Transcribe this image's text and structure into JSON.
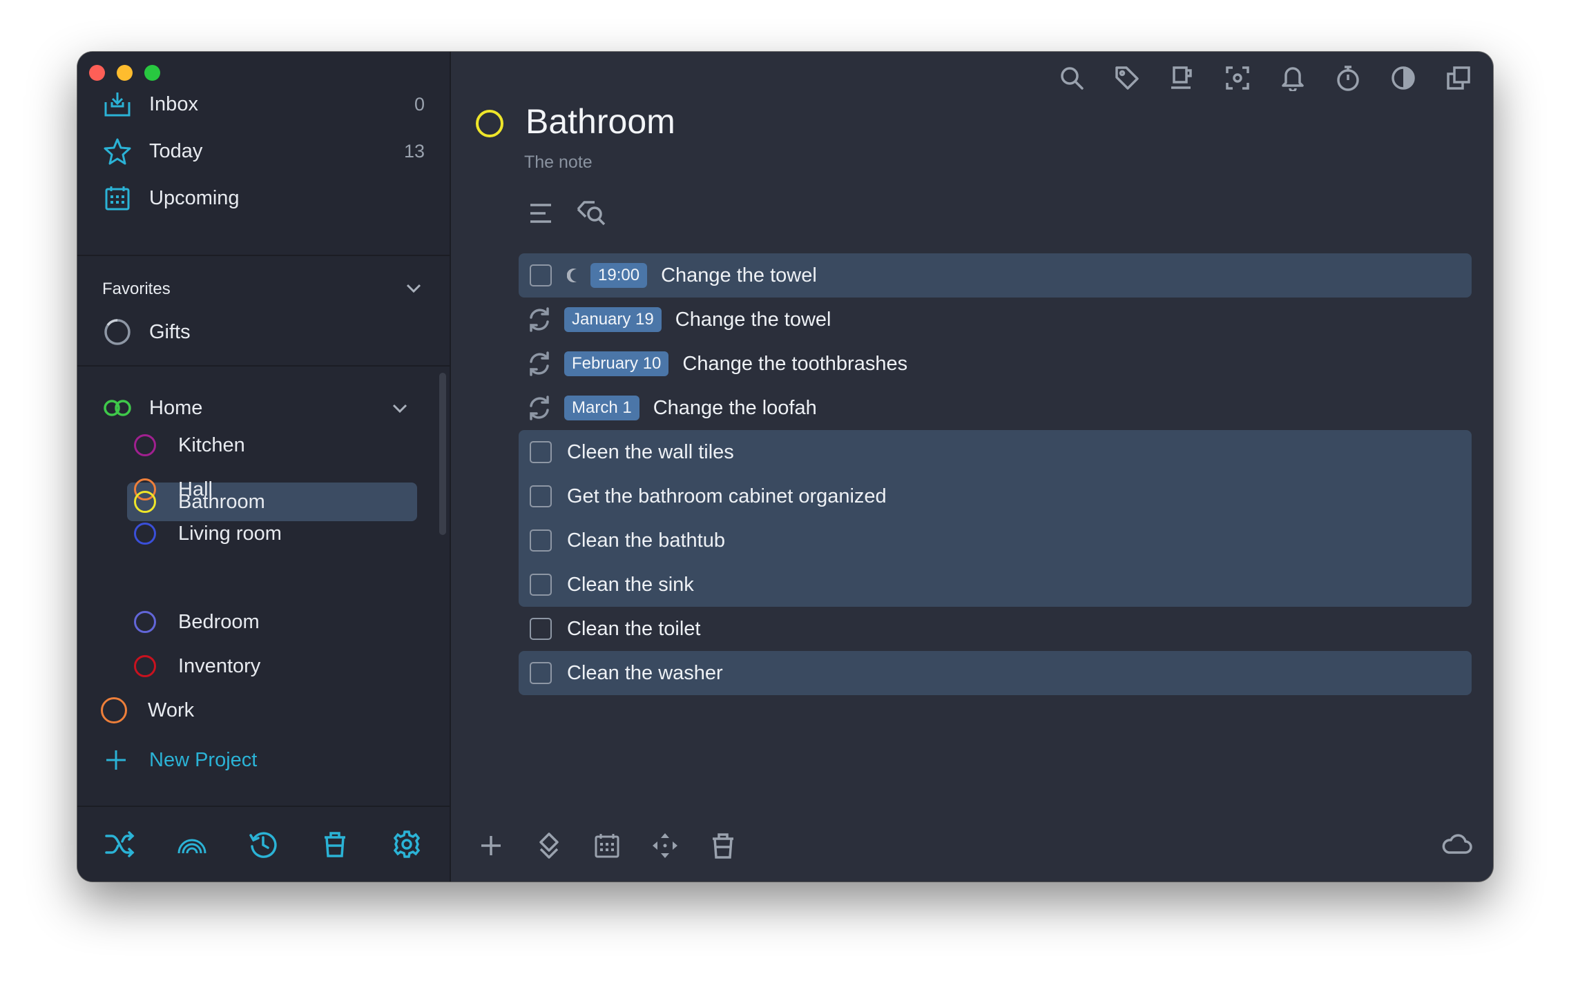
{
  "sidebar": {
    "nav": [
      {
        "label": "Inbox",
        "count": "0",
        "icon": "inbox-icon"
      },
      {
        "label": "Today",
        "count": "13",
        "icon": "star-icon"
      },
      {
        "label": "Upcoming",
        "count": "",
        "icon": "calendar-icon"
      }
    ],
    "favorites": {
      "label": "Favorites",
      "items": [
        {
          "label": "Gifts",
          "icon": "progress-ring-icon"
        }
      ]
    },
    "projects": {
      "home": {
        "label": "Home",
        "color": "#3fc84a"
      },
      "children": [
        {
          "label": "Kitchen",
          "color": "#a0208f"
        },
        {
          "label": "Hall",
          "color": "#ee7f3a"
        },
        {
          "label": "Living room",
          "color": "#3a4fd8"
        },
        {
          "label": "Bathroom",
          "color": "#eee52a",
          "selected": true
        },
        {
          "label": "Bedroom",
          "color": "#6266d8"
        },
        {
          "label": "Inventory",
          "color": "#c8121f"
        }
      ],
      "work": {
        "label": "Work",
        "color": "#ee7f3a"
      },
      "new_project": "New Project"
    },
    "bottom_icons": [
      "shuffle-icon",
      "rainbow-icon",
      "history-icon",
      "trash-icon",
      "gear-icon"
    ]
  },
  "main": {
    "title": "Bathroom",
    "note": "The note",
    "toolbar_icons": [
      "search-icon",
      "tag-icon",
      "coffee-icon",
      "focus-icon",
      "bell-icon",
      "timer-icon",
      "contrast-icon",
      "copy-icon"
    ],
    "tasks": [
      {
        "badge": "19:00",
        "label": "Change the towel",
        "type": "checkbox-moon"
      },
      {
        "badge": "January 19",
        "label": "Change the towel",
        "type": "repeat"
      },
      {
        "badge": "February 10",
        "label": "Change the toothbrashes",
        "type": "repeat"
      },
      {
        "badge": "March 1",
        "label": "Change the loofah",
        "type": "repeat"
      },
      {
        "label": "Cleen the wall tiles",
        "type": "checkbox"
      },
      {
        "label": "Get the bathroom cabinet organized",
        "type": "checkbox"
      },
      {
        "label": "Clean the bathtub",
        "type": "checkbox"
      },
      {
        "label": "Clean the sink",
        "type": "checkbox"
      },
      {
        "label": "Clean the toilet",
        "type": "checkbox"
      },
      {
        "label": "Clean the washer",
        "type": "checkbox"
      }
    ],
    "bottom_icons": [
      "plus-icon",
      "move-icon",
      "calendar-icon",
      "arrows-icon",
      "trash-icon",
      "cloud-icon"
    ]
  },
  "colors": {
    "accent": "#2bb3d6",
    "highlight": "#3a4a60",
    "badge": "#4b76a8"
  }
}
